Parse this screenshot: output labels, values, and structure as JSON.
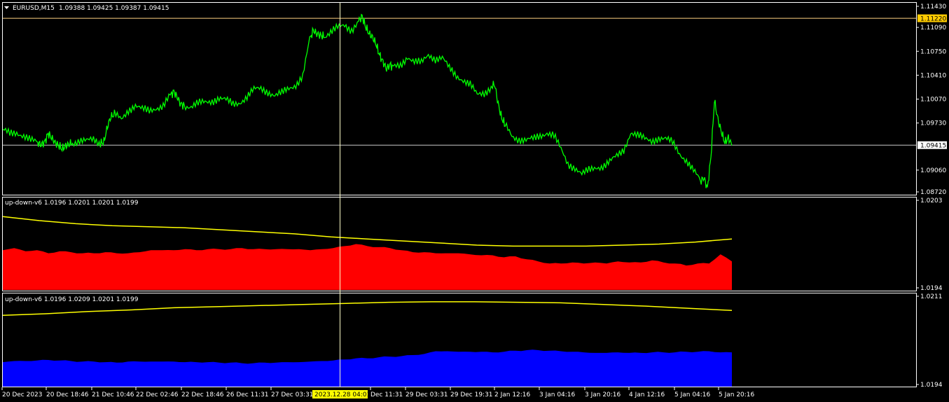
{
  "symbol_header": {
    "symbol": "EURUSD,M15",
    "ohlc": "1.09388 1.09425 1.09387 1.09415",
    "menu_icon": "triangle-down-icon"
  },
  "indicator1": {
    "title": "up-down-v6 1.0196 1.0201 1.0201 1.0199"
  },
  "indicator2": {
    "title": "up-down-v6 1.0196 1.0209 1.0201 1.0199"
  },
  "colors": {
    "background": "#000000",
    "price_line": "#00ff00",
    "indicator_red": "#ff0000",
    "indicator_blue": "#0000ff",
    "signal_line": "#ffff00",
    "grid_border": "#ffffff",
    "marker_line": "#ffd27f",
    "marker_label_bg": "#ffcc00"
  },
  "chart_data": [
    {
      "type": "line",
      "pane": "main",
      "series": [
        {
          "x": [
            0,
            10,
            20,
            30,
            40,
            50,
            55,
            60,
            65,
            70,
            75,
            80,
            85,
            90,
            95,
            100,
            110,
            120,
            130,
            140,
            145,
            150,
            155,
            160,
            170,
            180,
            190,
            200,
            210,
            220,
            230,
            240,
            245,
            250,
            255,
            260,
            270,
            280,
            290,
            300,
            310,
            320,
            330,
            340,
            350,
            360,
            370,
            380,
            390,
            400,
            410,
            420,
            430,
            440,
            445,
            450,
            455,
            460,
            470,
            480,
            490,
            500,
            510,
            515,
            520,
            525,
            530,
            535,
            540,
            545,
            550,
            555,
            560,
            570,
            580,
            590,
            600,
            610,
            620,
            630,
            640,
            650,
            660,
            670,
            680,
            690,
            700,
            705,
            710,
            715,
            720,
            730,
            740,
            750,
            760,
            770,
            780,
            790,
            800,
            810,
            820,
            830,
            840,
            850,
            860,
            870,
            880,
            890,
            900,
            910,
            920,
            930,
            940,
            950,
            960,
            970,
            980,
            990,
            1000,
            1005,
            1010,
            1015,
            1020,
            1025,
            1030,
            1035,
            1040,
            1045
          ],
          "values": [
            1.0962,
            1.0958,
            1.096,
            1.0955,
            1.0948,
            1.0945,
            1.0942,
            1.0946,
            1.0958,
            1.0952,
            1.0945,
            1.0941,
            1.0936,
            1.094,
            1.0943,
            1.0945,
            1.0948,
            1.0947,
            1.0949,
            1.0944,
            1.0946,
            1.0968,
            1.0982,
            1.0985,
            1.0978,
            1.0992,
            1.0998,
            1.0992,
            1.099,
            1.0995,
            1.0998,
            1.1012,
            1.1018,
            1.101,
            1.1,
            1.0998,
            1.0996,
            1.1,
            1.1003,
            1.1005,
            1.1008,
            1.1005,
            1.1,
            1.1003,
            1.101,
            1.102,
            1.1022,
            1.1018,
            1.1012,
            1.1015,
            1.1022,
            1.1028,
            1.104,
            1.1092,
            1.1105,
            1.11,
            1.1098,
            1.1096,
            1.1102,
            1.1108,
            1.1112,
            1.1106,
            1.1118,
            1.1125,
            1.111,
            1.11,
            1.1095,
            1.1085,
            1.107,
            1.106,
            1.105,
            1.1056,
            1.1052,
            1.1055,
            1.1068,
            1.106,
            1.1058,
            1.107,
            1.1065,
            1.1066,
            1.105,
            1.104,
            1.1035,
            1.1028,
            1.1012,
            1.1015,
            1.1025,
            1.1028,
            1.1,
            1.098,
            1.097,
            1.0955,
            1.095,
            1.0948,
            1.095,
            1.0955,
            1.096,
            1.0955,
            1.0935,
            1.0915,
            1.091,
            1.09,
            1.0905,
            1.091,
            1.0912,
            1.0918,
            1.0925,
            1.0935,
            1.096,
            1.0955,
            1.095,
            1.0948,
            1.0952,
            1.095,
            1.0945,
            1.093,
            1.092,
            1.0905,
            1.089,
            1.0895,
            1.088,
            1.0925,
            1.1005,
            1.0978,
            1.096,
            1.0945,
            1.0952,
            1.0941
          ]
        }
      ],
      "ylim": [
        1.0872,
        1.1143
      ],
      "y_ticks": [
        "1.11430",
        "1.11090",
        "1.10750",
        "1.10410",
        "1.10070",
        "1.09730",
        "1.09060",
        "1.08720"
      ],
      "y_tick_values": [
        1.1143,
        1.1109,
        1.1075,
        1.1041,
        1.1007,
        1.0973,
        1.0906,
        1.0872
      ],
      "price_label": "1.09415",
      "price_value": 1.09415,
      "marker_label": "1.11220",
      "marker_value": 1.1122
    },
    {
      "type": "area",
      "pane": "indicator1",
      "area_values": [
        1.01979,
        1.01981,
        1.01978,
        1.01979,
        1.01976,
        1.01978,
        1.01977,
        1.01976,
        1.01976,
        1.01977,
        1.01976,
        1.01976,
        1.01977,
        1.01979,
        1.01979,
        1.01979,
        1.0198,
        1.01979,
        1.0198,
        1.0198,
        1.0198,
        1.01981,
        1.0198,
        1.0198,
        1.0198,
        1.0198,
        1.0198,
        1.01979,
        1.0198,
        1.01981,
        1.01983,
        1.01985,
        1.01983,
        1.01982,
        1.01981,
        1.01979,
        1.01977,
        1.01977,
        1.01976,
        1.01976,
        1.01976,
        1.01975,
        1.01974,
        1.01974,
        1.01972,
        1.01973,
        1.0197,
        1.01968,
        1.01966,
        1.01966,
        1.01967,
        1.01966,
        1.01967,
        1.01966,
        1.01968,
        1.01967,
        1.01967,
        1.01969,
        1.01967,
        1.01966,
        1.01964,
        1.01966,
        1.01966,
        1.01975,
        1.01968
      ],
      "signal_values": [
        1.02012,
        1.02008,
        1.02005,
        1.02003,
        1.02002,
        1.02001,
        1.01999,
        1.01997,
        1.01995,
        1.01992,
        1.0199,
        1.01988,
        1.01986,
        1.01984,
        1.01983,
        1.01983,
        1.01983,
        1.01984,
        1.01985,
        1.01987,
        1.0199
      ],
      "ylim": [
        1.0194,
        1.0203
      ],
      "y_ticks": [
        "1.0203",
        "1.0194"
      ],
      "y_tick_values": [
        1.0203,
        1.0194
      ]
    },
    {
      "type": "area",
      "pane": "indicator2",
      "area_values": [
        1.01985,
        1.01987,
        1.01987,
        1.01988,
        1.01989,
        1.01988,
        1.01987,
        1.01986,
        1.01986,
        1.01985,
        1.01984,
        1.01986,
        1.01986,
        1.01986,
        1.01986,
        1.01986,
        1.01985,
        1.01985,
        1.01985,
        1.01984,
        1.01984,
        1.01983,
        1.01983,
        1.01984,
        1.01984,
        1.01985,
        1.01985,
        1.01986,
        1.01987,
        1.01988,
        1.0199,
        1.01992,
        1.01992,
        1.01994,
        1.01995,
        1.01996,
        1.01998,
        1.02,
        1.02005,
        1.02005,
        1.02004,
        1.02004,
        1.02004,
        1.02003,
        1.02004,
        1.02006,
        1.02007,
        1.02007,
        1.02006,
        1.02005,
        1.02004,
        1.02003,
        1.02002,
        1.02002,
        1.02003,
        1.02002,
        1.02002,
        1.02003,
        1.02003,
        1.02003,
        1.02004,
        1.02004,
        1.02005,
        1.02003,
        1.02003
      ],
      "signal_values": [
        1.02071,
        1.02074,
        1.02078,
        1.02081,
        1.02085,
        1.02087,
        1.02089,
        1.02091,
        1.02093,
        1.02095,
        1.02096,
        1.02096,
        1.02095,
        1.02094,
        1.02091,
        1.02088,
        1.02084,
        1.0208
      ],
      "ylim": [
        1.0194,
        1.0211
      ],
      "y_ticks": [
        "1.0211",
        "1.0194"
      ],
      "y_tick_values": [
        1.0211,
        1.0194
      ]
    }
  ],
  "time_axis": {
    "labels": [
      "20 Dec 2023",
      "20 Dec 18:46",
      "21 Dec 10:46",
      "22 Dec 02:46",
      "22 Dec 18:46",
      "26 Dec 11:31",
      "27 Dec 03:31",
      "Dec 11:31",
      "29 Dec 03:31",
      "29 Dec 19:31",
      "2 Jan 12:16",
      "3 Jan 04:16",
      "3 Jan 20:16",
      "4 Jan 12:16",
      "5 Jan 04:16",
      "5 Jan 20:16"
    ],
    "crosshair_label": "2023.12.28 04:01"
  }
}
